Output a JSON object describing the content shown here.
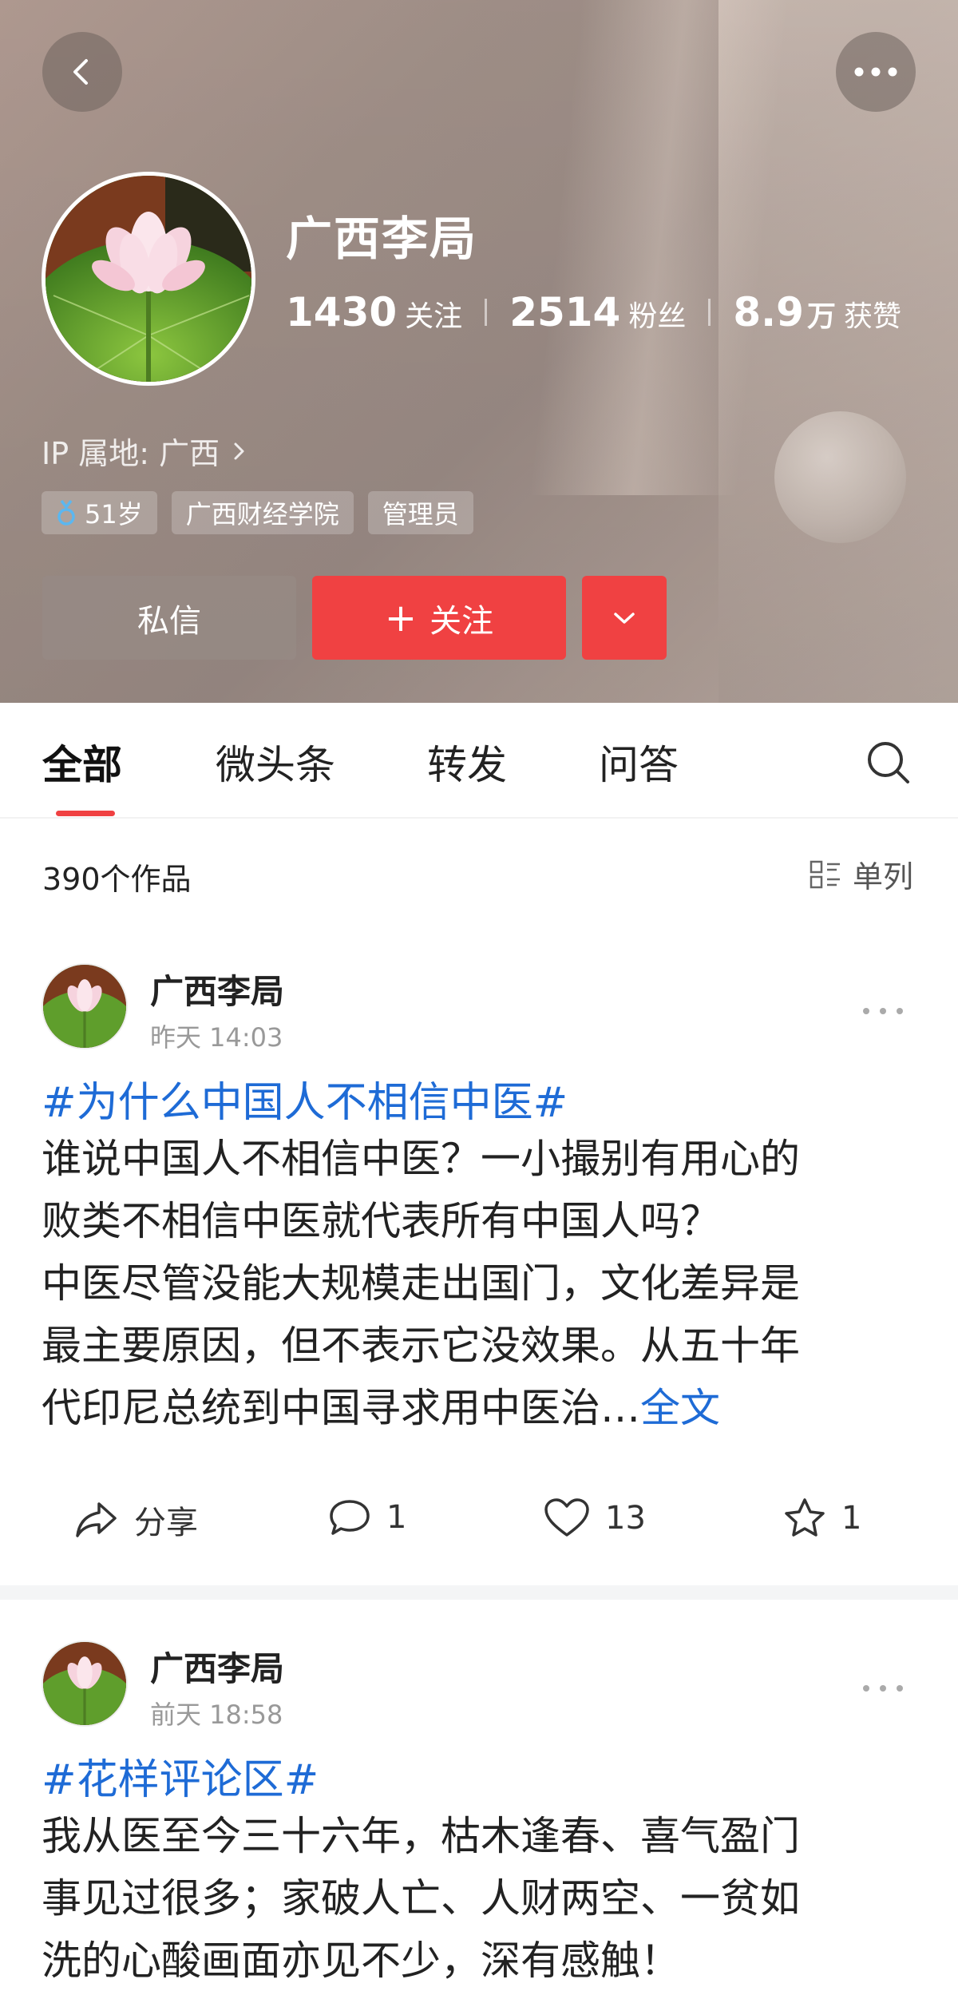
{
  "profile": {
    "name": "广西李局",
    "stats": [
      {
        "num": "1430",
        "unit": "",
        "label": "关注"
      },
      {
        "num": "2514",
        "unit": "",
        "label": "粉丝"
      },
      {
        "num": "8.9",
        "unit": "万",
        "label": "获赞"
      }
    ],
    "ip_location": "IP 属地: 广西",
    "tags": {
      "age": "51岁",
      "school": "广西财经学院",
      "role": "管理员"
    },
    "buttons": {
      "message": "私信",
      "follow": "关注"
    }
  },
  "tabs": [
    "全部",
    "微头条",
    "转发",
    "问答"
  ],
  "works_count": "390个作品",
  "layout_label": "单列",
  "posts": [
    {
      "author": "广西李局",
      "time": "昨天  14:03",
      "topic": "#为什么中国人不相信中医#",
      "lines": [
        "谁说中国人不相信中医？一小撮别有用心的",
        "败类不相信中医就代表所有中国人吗？",
        "中医尽管没能大规模走出国门，文化差异是",
        "最主要原因，但不表示它没效果。从五十年",
        "代印尼总统到中国寻求用中医治…"
      ],
      "fulltext": "全文",
      "share_label": "分享",
      "comments": "1",
      "likes": "13",
      "favorites": "1"
    },
    {
      "author": "广西李局",
      "time": "前天  18:58",
      "topic": "#花样评论区#",
      "lines": [
        "我从医至今三十六年，枯木逢春、喜气盈门",
        "事见过很多；家破人亡、人财两空、一贫如",
        "洗的心酸画面亦见不少，深有感触！"
      ]
    }
  ],
  "colors": {
    "accent_red": "#f04142",
    "link_blue": "#1e6bd6"
  }
}
